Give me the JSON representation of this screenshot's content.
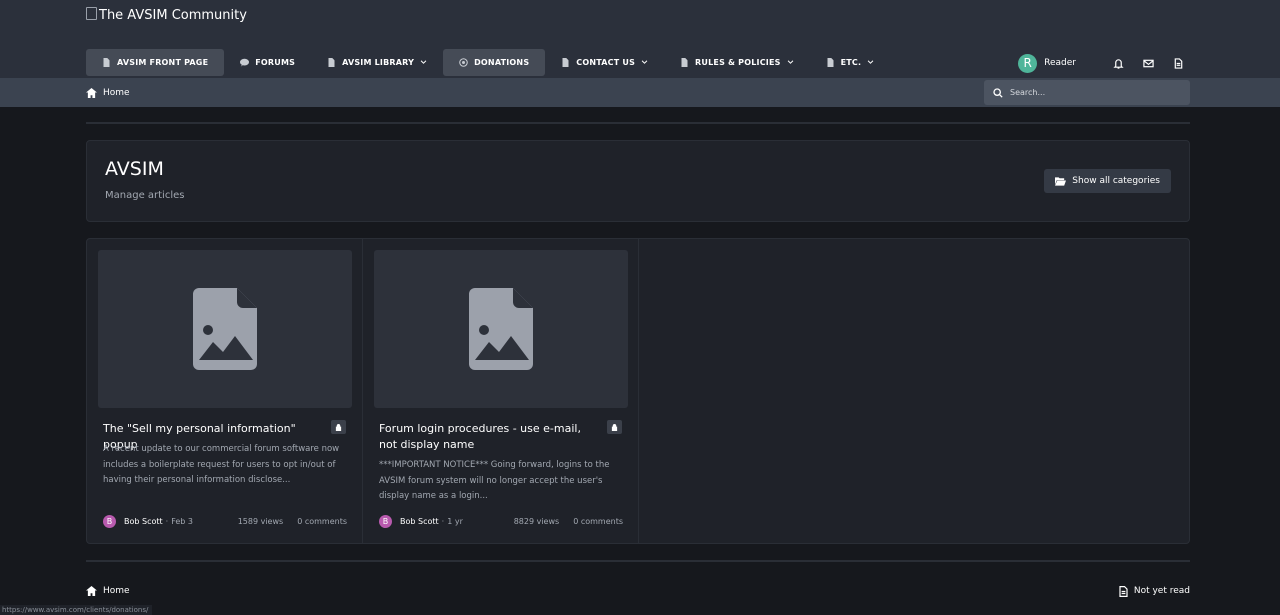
{
  "header": {
    "logo_text": "The AVSIM Community",
    "nav": [
      {
        "label": "AVSIM FRONT PAGE",
        "icon": "document-icon",
        "active": true,
        "dropdown": false
      },
      {
        "label": "FORUMS",
        "icon": "chat-bubble-icon",
        "active": false,
        "dropdown": false
      },
      {
        "label": "AVSIM LIBRARY",
        "icon": "document-icon",
        "active": false,
        "dropdown": true
      },
      {
        "label": "DONATIONS",
        "icon": "donation-icon",
        "active": true,
        "dropdown": false
      },
      {
        "label": "CONTACT US",
        "icon": "document-icon",
        "active": false,
        "dropdown": true
      },
      {
        "label": "RULES & POLICIES",
        "icon": "document-icon",
        "active": false,
        "dropdown": true
      },
      {
        "label": "ETC.",
        "icon": "document-icon",
        "active": false,
        "dropdown": true
      }
    ],
    "user": {
      "avatar_letter": "R",
      "name": "Reader",
      "avatar_color": "#4fb59a"
    }
  },
  "breadcrumb": {
    "home_label": "Home"
  },
  "search": {
    "placeholder": "Search..."
  },
  "hero": {
    "title": "AVSIM",
    "subtitle": "Manage articles",
    "show_categories_label": "Show all categories"
  },
  "articles": [
    {
      "title": "The \"Sell my personal information\" popup",
      "description": "A recent update to our commercial forum software now includes a boilerplate request for users to opt in/out of having their personal information disclose...",
      "author_initial": "B",
      "author": "Bob Scott",
      "date": "Feb 3",
      "views": "1589 views",
      "comments": "0 comments",
      "locked": true
    },
    {
      "title": "Forum login procedures - use e-mail, not display name",
      "description": "***IMPORTANT NOTICE*** Going forward, logins to the AVSIM forum system will no longer accept the user's display name as a login...",
      "author_initial": "B",
      "author": "Bob Scott",
      "date": "1 yr",
      "views": "8829 views",
      "comments": "0 comments",
      "locked": true
    }
  ],
  "footer": {
    "home_label": "Home",
    "not_read_label": "Not yet read"
  },
  "status_url": "https://www.avsim.com/clients/donations/",
  "colors": {
    "accent_avatar": "#4fb59a",
    "author_avatar": "#b85aae",
    "header_bg": "#2b303b"
  }
}
